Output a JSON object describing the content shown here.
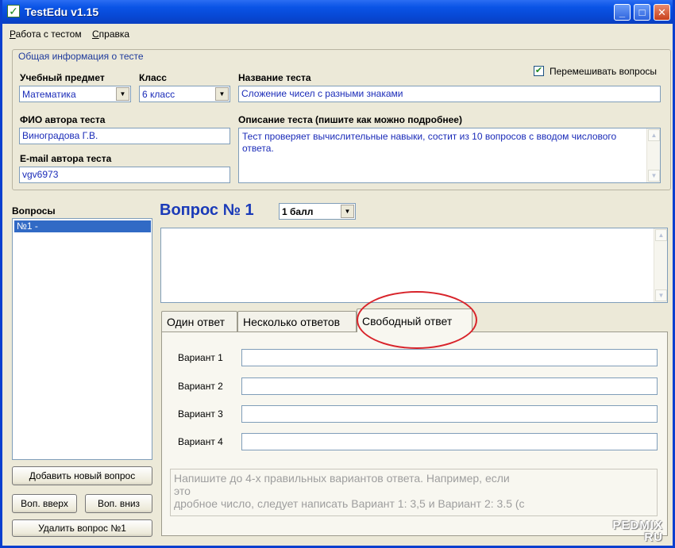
{
  "window": {
    "title": "TestEdu v1.15"
  },
  "menu": [
    {
      "label": "Работа с тестом",
      "accel": "Р",
      "rest": "абота с тестом"
    },
    {
      "label": "Справка",
      "accel": "С",
      "rest": "правка"
    }
  ],
  "general": {
    "legend": "Общая информация о тесте",
    "subject_label": "Учебный предмет",
    "subject_value": "Математика",
    "class_label": "Класс",
    "class_value": "6 класс",
    "test_name_label": "Название теста",
    "test_name_value": "Сложение чисел с разными знаками",
    "author_label": "ФИО автора теста",
    "author_value": "Виноградова Г.В.",
    "email_label": "E-mail автора теста",
    "email_value": "vgv6973",
    "description_label": "Описание теста (пишите как можно подробнее)",
    "description_value": "Тест проверяет вычислительные навыки, состит из 10 вопросов с вводом числового ответа.",
    "shuffle_label": "Перемешивать вопросы",
    "shuffle_checked": "✔"
  },
  "questions": {
    "label": "Вопросы",
    "items": [
      "№1 -"
    ],
    "add_button": "Добавить новый вопрос",
    "up_button": "Воп. вверх",
    "down_button": "Воп. вниз",
    "delete_button": "Удалить вопрос №1"
  },
  "question": {
    "title": "Вопрос № 1",
    "score_value": "1 балл"
  },
  "tabs": [
    {
      "label": "Один ответ"
    },
    {
      "label": "Несколько ответов"
    },
    {
      "label": "Свободный ответ"
    }
  ],
  "variants": [
    {
      "label": "Вариант 1"
    },
    {
      "label": "Вариант 2"
    },
    {
      "label": "Вариант 3"
    },
    {
      "label": "Вариант 4"
    }
  ],
  "hint": "Напишите до 4-х правильных вариантов ответа. Например, если\nэто\nдробное число, следует написать Вариант 1: 3,5 и Вариант 2: 3.5 (с",
  "watermark": {
    "line1": "PEDMIX",
    "line2": "RU"
  },
  "colors": {
    "accent": "#0a54e6",
    "field_text": "#1a2bb8",
    "highlight": "#d8232a",
    "selection": "#316ac5"
  }
}
